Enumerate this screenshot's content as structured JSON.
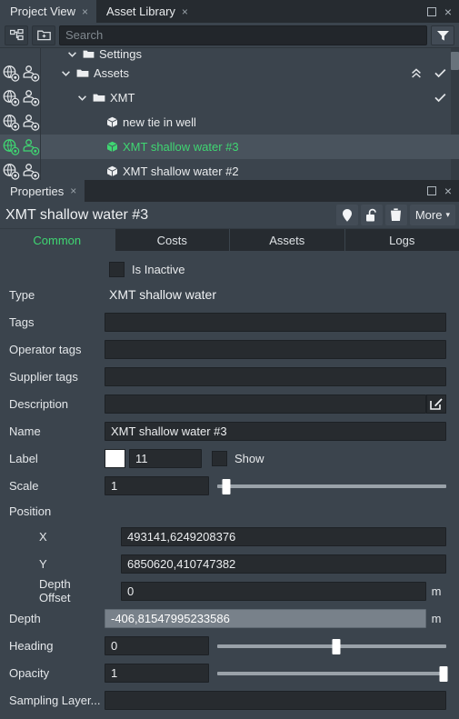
{
  "window": {
    "tabs": [
      {
        "label": "Project View",
        "active": true,
        "closable": true
      },
      {
        "label": "Asset Library",
        "active": false,
        "closable": true
      }
    ],
    "close_glyph": "×",
    "maximize_name": "maximize",
    "close_name": "close"
  },
  "toolbar": {
    "hierarchy_icon": "tree-hierarchy-icon",
    "new_folder_icon": "new-folder-icon",
    "filter_icon": "filter-funnel-icon"
  },
  "search": {
    "value": "",
    "placeholder": "Search"
  },
  "tree": {
    "collapse_all_glyph": "«",
    "check_glyph": "✓",
    "chevron_glyph": "⌄",
    "rows": [
      {
        "label": "Settings",
        "indent": 0,
        "type": "folder",
        "clipped": true,
        "selected": false,
        "expanded": true,
        "has_check": false,
        "has_collapse": false
      },
      {
        "label": "Assets",
        "indent": 1,
        "type": "folder",
        "clipped": false,
        "selected": false,
        "expanded": true,
        "has_check": true,
        "has_collapse": true
      },
      {
        "label": "XMT",
        "indent": 2,
        "type": "folder",
        "clipped": false,
        "selected": false,
        "expanded": true,
        "has_check": true,
        "has_collapse": false
      },
      {
        "label": "new tie in well",
        "indent": 3,
        "type": "item",
        "clipped": false,
        "selected": false,
        "expanded": false,
        "has_check": false,
        "has_collapse": false
      },
      {
        "label": "XMT shallow water #3",
        "indent": 3,
        "type": "item",
        "clipped": false,
        "selected": true,
        "expanded": false,
        "has_check": false,
        "has_collapse": false
      },
      {
        "label": "XMT shallow water #2",
        "indent": 3,
        "type": "item",
        "clipped": false,
        "selected": false,
        "expanded": false,
        "has_check": false,
        "has_collapse": false
      }
    ]
  },
  "properties": {
    "tab_label": "Properties",
    "close_glyph": "×",
    "title": "XMT shallow water #3",
    "actions": {
      "locate_icon": "map-pin-icon",
      "lock_icon": "unlocked-padlock-icon",
      "delete_icon": "trash-icon",
      "more_label": "More",
      "more_caret": "▾"
    },
    "section_tabs": [
      {
        "label": "Common",
        "active": true
      },
      {
        "label": "Costs",
        "active": false
      },
      {
        "label": "Assets",
        "active": false
      },
      {
        "label": "Logs",
        "active": false
      }
    ],
    "is_inactive": {
      "label": "Is Inactive",
      "checked": false
    },
    "fields": {
      "type": {
        "label": "Type",
        "value": "XMT shallow water"
      },
      "tags": {
        "label": "Tags",
        "value": ""
      },
      "operator_tags": {
        "label": "Operator tags",
        "value": ""
      },
      "supplier_tags": {
        "label": "Supplier tags",
        "value": ""
      },
      "description": {
        "label": "Description",
        "value": "",
        "edit_icon": "edit-pencil-icon"
      },
      "name": {
        "label": "Name",
        "value": "XMT shallow water #3"
      },
      "label": {
        "label": "Label",
        "color": "#ffffff",
        "size": "11",
        "show_label": "Show",
        "show_checked": false
      },
      "scale": {
        "label": "Scale",
        "value": "1",
        "slider_percent": 4
      },
      "position": {
        "label": "Position"
      },
      "x": {
        "label": "X",
        "value": "493141,6249208376"
      },
      "y": {
        "label": "Y",
        "value": "6850620,410747382"
      },
      "depth_offset": {
        "label": "Depth Offset",
        "value": "0",
        "unit": "m"
      },
      "depth": {
        "label": "Depth",
        "value": "-406,81547995233586",
        "unit": "m",
        "readonly": true
      },
      "heading": {
        "label": "Heading",
        "value": "0",
        "slider_percent": 52
      },
      "opacity": {
        "label": "Opacity",
        "value": "1",
        "slider_percent": 99
      },
      "sampling_layer": {
        "label": "Sampling Layer...",
        "value": ""
      }
    }
  },
  "colors": {
    "accent_green": "#3fd672",
    "panel_bg": "#3b444d",
    "tabbar_bg": "#262b30",
    "selection_bg": "#49535d",
    "input_bg": "#272b2f"
  }
}
